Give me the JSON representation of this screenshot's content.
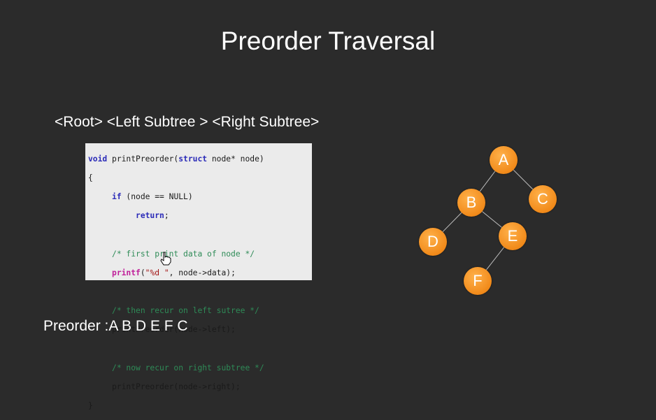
{
  "slide": {
    "title": "Preorder Traversal",
    "subtitle": "<Root> <Left Subtree > <Right Subtree>",
    "result": "Preorder :A B D E F C"
  },
  "code": {
    "l1_kw1": "void",
    "l1_rest1": " printPreorder(",
    "l1_kw2": "struct",
    "l1_rest2": " node* node)",
    "l2": "{",
    "l3_indent": "     ",
    "l3_kw": "if",
    "l3_rest": " (node == NULL)",
    "l4_indent": "          ",
    "l4_kw": "return",
    "l4_rest": ";",
    "l5_indent": "     ",
    "l5_comment": "/* first print data of node */",
    "l6_indent": "     ",
    "l6_fn": "printf",
    "l6_open": "(",
    "l6_str": "\"%d \"",
    "l6_rest": ", node->data);",
    "l7_indent": "     ",
    "l7_comment": "/* then recur on left sutree */",
    "l8": "     printPreorder(node->left);",
    "l9_indent": "     ",
    "l9_comment": "/* now recur on right subtree */",
    "l10": "     printPreorder(node->right);",
    "l11": "}"
  },
  "tree": {
    "nodes": [
      "A",
      "B",
      "C",
      "D",
      "E",
      "F"
    ],
    "edges": [
      [
        "A",
        "B"
      ],
      [
        "A",
        "C"
      ],
      [
        "B",
        "D"
      ],
      [
        "B",
        "E"
      ],
      [
        "E",
        "F"
      ]
    ],
    "node_color": "#f18a1a",
    "edge_color": "#bfbfbf"
  },
  "colors": {
    "background": "#2b2b2b",
    "text": "#ffffff",
    "code_background": "#ebebeb"
  },
  "icons": {
    "cursor": "hand-pointer-icon"
  }
}
